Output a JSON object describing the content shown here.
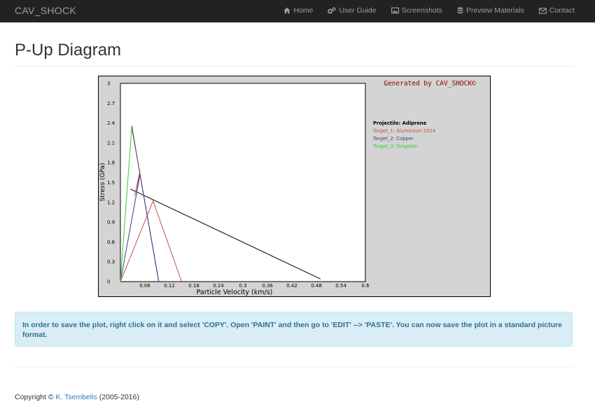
{
  "navbar": {
    "brand": "CAV_SHOCK",
    "items": [
      {
        "label": "Home",
        "icon": "home-icon"
      },
      {
        "label": "User Guide",
        "icon": "gears-icon"
      },
      {
        "label": "Screenshots",
        "icon": "picture-icon"
      },
      {
        "label": "Preview Materials",
        "icon": "database-icon"
      },
      {
        "label": "Contact",
        "icon": "envelope-icon"
      }
    ]
  },
  "page": {
    "title": "P-Up Diagram"
  },
  "chart_data": {
    "type": "line",
    "generated_by": "Generated by CAV_SHOCK©",
    "xlabel": "Particle Velocity (km/s)",
    "ylabel": "Stress (GPa)",
    "xlim": [
      0,
      0.6
    ],
    "ylim": [
      0,
      3
    ],
    "x_ticks": [
      "0.06",
      "0.12",
      "0.18",
      "0.24",
      "0.3",
      "0.36",
      "0.42",
      "0.48",
      "0.54",
      "0.6"
    ],
    "x_tick_values": [
      0.06,
      0.12,
      0.18,
      0.24,
      0.3,
      0.36,
      0.42,
      0.48,
      0.54,
      0.6
    ],
    "y_ticks": [
      "0",
      "0.3",
      "0.6",
      "0.9",
      "1.2",
      "1.5",
      "1.8",
      "2.1",
      "2.4",
      "2.7",
      "3"
    ],
    "y_tick_values": [
      0,
      0.3,
      0.6,
      0.9,
      1.2,
      1.5,
      1.8,
      2.1,
      2.4,
      2.7,
      3
    ],
    "legend": [
      {
        "label": "Projectile: Adiprene",
        "color": "#000000"
      },
      {
        "label": "Target_1: Aluminium 2024",
        "color": "#c0504d"
      },
      {
        "label": "Target_2: Copper",
        "color": "#3f3f7f"
      },
      {
        "label": "Target_3: Tungsten",
        "color": "#33cc33"
      }
    ],
    "series": [
      {
        "color": "#000000",
        "points": [
          [
            0.025,
            1.4
          ],
          [
            0.49,
            0.04
          ]
        ]
      },
      {
        "color": "#c0504d",
        "points": [
          [
            0,
            0
          ],
          [
            0.08,
            1.22
          ],
          [
            0.15,
            0
          ]
        ]
      },
      {
        "color": "#c0504d",
        "points": [
          [
            0.035,
            1.3
          ],
          [
            0.048,
            1.68
          ],
          [
            0.038,
            1.28
          ],
          [
            0.047,
            1.62
          ]
        ]
      },
      {
        "color": "#3f3f7f",
        "points": [
          [
            0,
            0
          ],
          [
            0.048,
            1.62
          ],
          [
            0.094,
            0
          ]
        ]
      },
      {
        "color": "#3f3f7f",
        "points": [
          [
            0.028,
            2.33
          ],
          [
            0.094,
            0
          ]
        ]
      },
      {
        "color": "#33cc33",
        "points": [
          [
            0,
            0
          ],
          [
            0.028,
            2.36
          ]
        ]
      },
      {
        "color": "#555555",
        "points": [
          [
            0.028,
            2.36
          ],
          [
            0.048,
            1.62
          ]
        ]
      }
    ]
  },
  "alert": {
    "text": "In order to save the plot, right click on it and select 'COPY'. Open 'PAINT' and then go to 'EDIT' --> 'PASTE'. You can now save the plot in a standard picture",
    "text2": "format."
  },
  "footer": {
    "prefix": "Copyright © ",
    "author": "K. Tsembelis",
    "suffix": " (2005-2016)"
  }
}
